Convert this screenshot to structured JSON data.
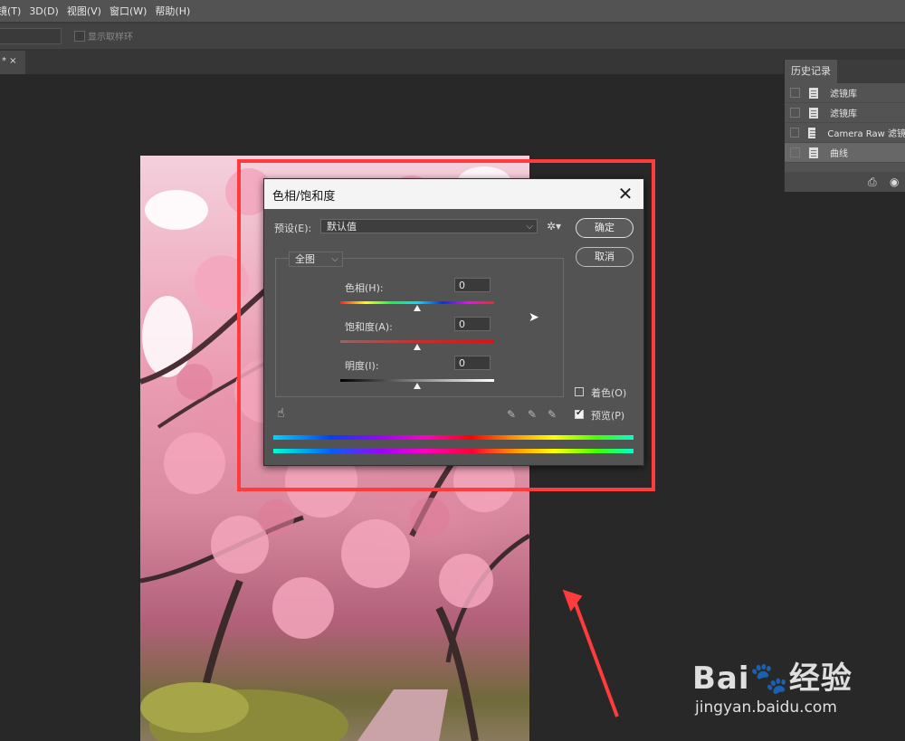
{
  "menubar": {
    "items": [
      "镜(T)",
      "3D(D)",
      "视图(V)",
      "窗口(W)",
      "帮助(H)"
    ]
  },
  "options_bar": {
    "show_sampling_ring_label": "显示取样环"
  },
  "doc_tab": {
    "label": "* ×"
  },
  "history_panel": {
    "tab_label": "历史记录",
    "items": [
      {
        "label": "滤镜库"
      },
      {
        "label": "滤镜库"
      },
      {
        "label": "Camera Raw 滤镜"
      },
      {
        "label": "曲线"
      }
    ]
  },
  "dialog": {
    "title": "色相/饱和度",
    "close_glyph": "✕",
    "preset_label": "预设(E):",
    "preset_value": "默认值",
    "ok_label": "确定",
    "cancel_label": "取消",
    "channel_value": "全图",
    "hue": {
      "label": "色相(H):",
      "value": "0"
    },
    "saturation": {
      "label": "饱和度(A):",
      "value": "0"
    },
    "lightness": {
      "label": "明度(I):",
      "value": "0"
    },
    "colorize_label": "着色(O)",
    "colorize_checked": false,
    "preview_label": "预览(P)",
    "preview_checked": true
  },
  "watermark": {
    "logo_text": "Bai🐾经验",
    "url": "jingyan.baidu.com"
  },
  "colors": {
    "highlight": "#ff3b3b",
    "panel_bg": "#535353",
    "canvas_bg": "#282828"
  }
}
